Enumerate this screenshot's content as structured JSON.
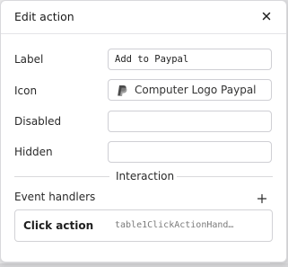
{
  "dialog": {
    "title": "Edit action",
    "close_icon": "close-icon"
  },
  "fields": {
    "label": {
      "name": "Label",
      "value": "Add to Paypal"
    },
    "icon": {
      "name": "Icon",
      "value": "Computer Logo Paypal",
      "icon": "paypal-logo-icon"
    },
    "disabled": {
      "name": "Disabled",
      "value": ""
    },
    "hidden": {
      "name": "Hidden",
      "value": ""
    }
  },
  "interaction": {
    "section_title": "Interaction",
    "event_handlers_label": "Event handlers",
    "add_icon": "plus-icon",
    "handlers": [
      {
        "event": "Click action",
        "target": "table1ClickActionHand…"
      }
    ]
  },
  "colors": {
    "border": "#cfcfd4",
    "text": "#1f1f1f",
    "muted": "#7a7a7a",
    "paypal_dark": "#253b80",
    "paypal_light": "#179bd7"
  }
}
